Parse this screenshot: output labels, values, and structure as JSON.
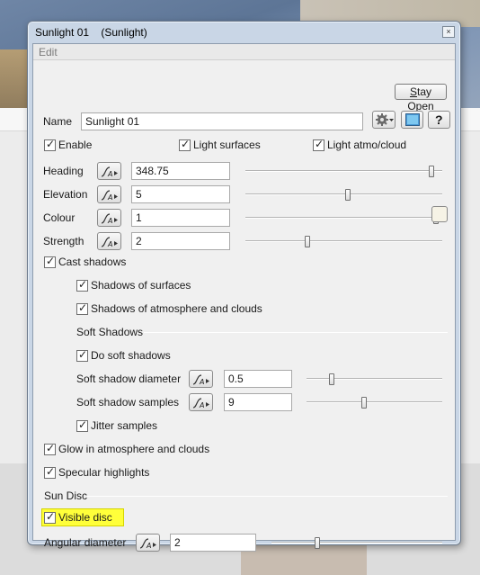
{
  "window": {
    "title": "Sunlight 01    (Sunlight)",
    "close": "×"
  },
  "menu": {
    "edit": "Edit"
  },
  "stay_open": {
    "label_prefix": "S",
    "label_rest": "tay Open"
  },
  "name": {
    "label": "Name",
    "value": "Sunlight 01"
  },
  "checks_top": {
    "enable": "Enable",
    "light_surfaces": "Light surfaces",
    "light_atmo": "Light atmo/cloud"
  },
  "params": [
    {
      "label": "Heading",
      "value": "348.75",
      "slider_fraction": 0.96
    },
    {
      "label": "Elevation",
      "value": "5",
      "slider_fraction": 0.52
    },
    {
      "label": "Colour",
      "value": "1",
      "slider_fraction": 0.98
    },
    {
      "label": "Strength",
      "value": "2",
      "slider_fraction": 0.31
    }
  ],
  "shadows": {
    "cast": "Cast shadows",
    "of_surfaces": "Shadows of surfaces",
    "of_atmo": "Shadows of atmosphere and clouds",
    "soft_heading": "Soft Shadows",
    "do_soft": "Do soft shadows",
    "diameter": {
      "label": "Soft shadow diameter",
      "value": "0.5",
      "slider_fraction": 0.17
    },
    "samples": {
      "label": "Soft shadow samples",
      "value": "9",
      "slider_fraction": 0.42
    },
    "jitter": "Jitter samples"
  },
  "glow": "Glow in atmosphere and clouds",
  "specular": "Specular highlights",
  "sun_disc": {
    "heading": "Sun Disc",
    "visible": "Visible disc",
    "angular": {
      "label": "Angular diameter",
      "value": "2",
      "slider_fraction": 0.26
    }
  },
  "colors": {
    "highlight": "#ffff3a",
    "window_frame": "#c9d6e6"
  },
  "icons": [
    "gear-icon",
    "preview-icon",
    "help-icon",
    "animation-curve-icon",
    "close-icon"
  ]
}
